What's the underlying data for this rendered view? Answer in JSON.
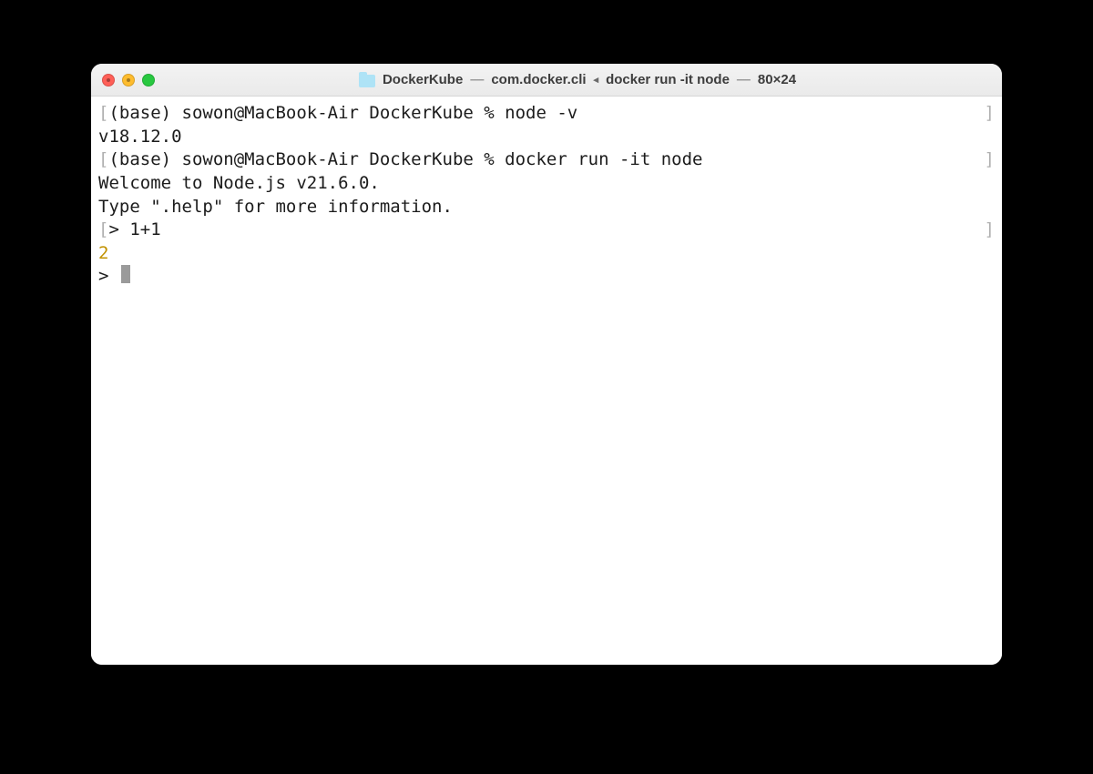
{
  "titlebar": {
    "folder": "DockerKube",
    "process": "com.docker.cli",
    "command": "docker run -it node",
    "size": "80×24"
  },
  "terminal": {
    "lines": [
      {
        "bracketed": true,
        "text": "(base) sowon@MacBook-Air DockerKube % node -v"
      },
      {
        "bracketed": false,
        "text": "v18.12.0"
      },
      {
        "bracketed": true,
        "text": "(base) sowon@MacBook-Air DockerKube % docker run -it node"
      },
      {
        "bracketed": false,
        "text": "Welcome to Node.js v21.6.0."
      },
      {
        "bracketed": false,
        "text": "Type \".help\" for more information."
      },
      {
        "bracketed": true,
        "text": "> 1+1"
      },
      {
        "bracketed": false,
        "text": "2",
        "class": "yellow"
      },
      {
        "bracketed": false,
        "text": "> ",
        "cursor": true
      }
    ]
  }
}
